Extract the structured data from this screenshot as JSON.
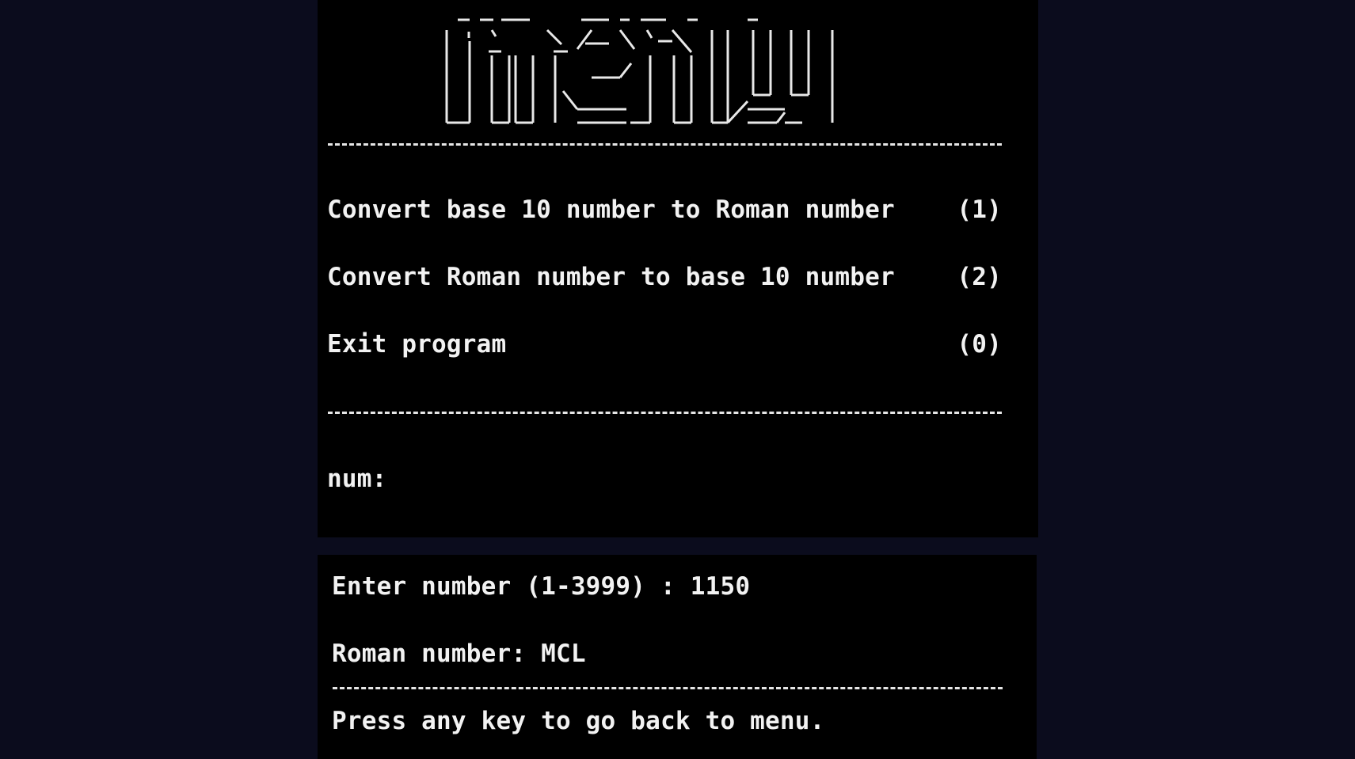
{
  "menu": {
    "banner_text": "menu",
    "items": [
      {
        "label": "Convert base 10 number to Roman number",
        "key": "(1)"
      },
      {
        "label": "Convert Roman number to base 10 number",
        "key": "(2)"
      },
      {
        "label": "Exit program",
        "key": "(0)"
      }
    ],
    "prompt": "num:"
  },
  "result": {
    "enter_line": "Enter number (1-3999) : 1150",
    "roman_line": "Roman number: MCL",
    "back_line": "Press any key to go back to menu."
  },
  "colors": {
    "background": "#0b0c1d",
    "terminal": "#000000",
    "text": "#f2f2f2"
  }
}
